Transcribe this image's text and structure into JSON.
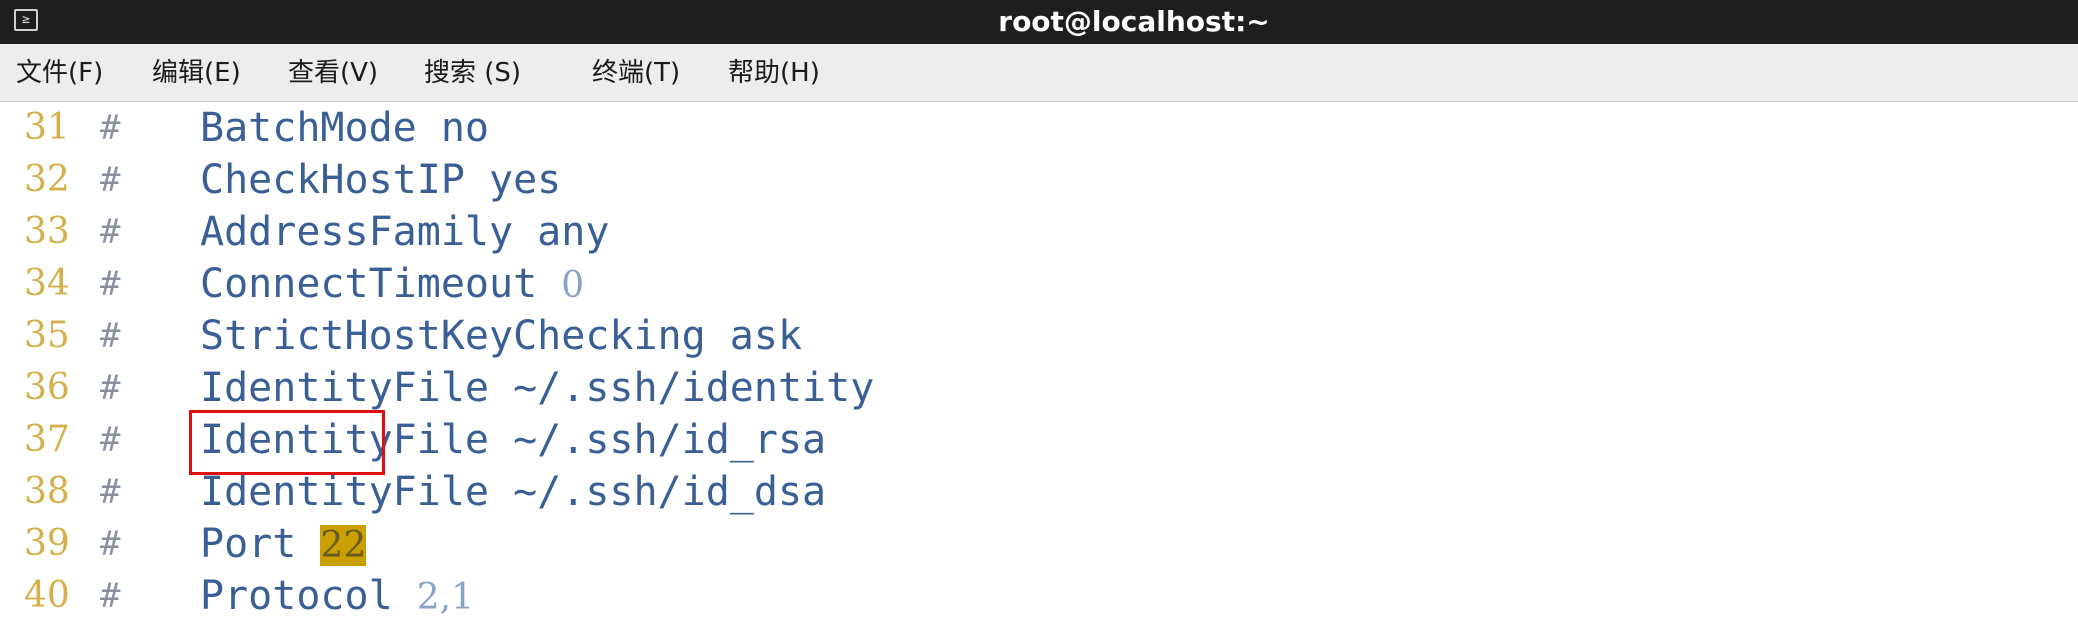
{
  "window": {
    "title": "root@localhost:~",
    "icon": "terminal-icon",
    "icon_glyph": "≥"
  },
  "menu": {
    "items": [
      {
        "label": "文件(F)"
      },
      {
        "label": "编辑(E)"
      },
      {
        "label": "查看(V)"
      },
      {
        "label": "搜索 (S)"
      },
      {
        "label": "终端(T)"
      },
      {
        "label": "帮助(H)"
      }
    ]
  },
  "editor": {
    "comment_mark": "#",
    "lines": [
      {
        "num": "31",
        "text": "BatchMode no",
        "value": ""
      },
      {
        "num": "32",
        "text": "CheckHostIP yes",
        "value": ""
      },
      {
        "num": "33",
        "text": "AddressFamily any",
        "value": ""
      },
      {
        "num": "34",
        "text": "ConnectTimeout ",
        "value": "0"
      },
      {
        "num": "35",
        "text": "StrictHostKeyChecking ask",
        "value": ""
      },
      {
        "num": "36",
        "text": "IdentityFile ~/.ssh/identity",
        "value": ""
      },
      {
        "num": "37",
        "text": "IdentityFile ~/.ssh/id_rsa",
        "value": ""
      },
      {
        "num": "38",
        "text": "IdentityFile ~/.ssh/id_dsa",
        "value": ""
      },
      {
        "num": "39",
        "text": "Port ",
        "value": "22"
      },
      {
        "num": "40",
        "text": "Protocol ",
        "value": "2,1"
      }
    ]
  },
  "colors": {
    "titlebar": "#1e1e1e",
    "line_number": "#d4b04a",
    "code_text": "#3a5f96",
    "numeric_value": "#8aa2c6",
    "search_highlight": "#c9a000",
    "annotation_box": "#e01010"
  }
}
